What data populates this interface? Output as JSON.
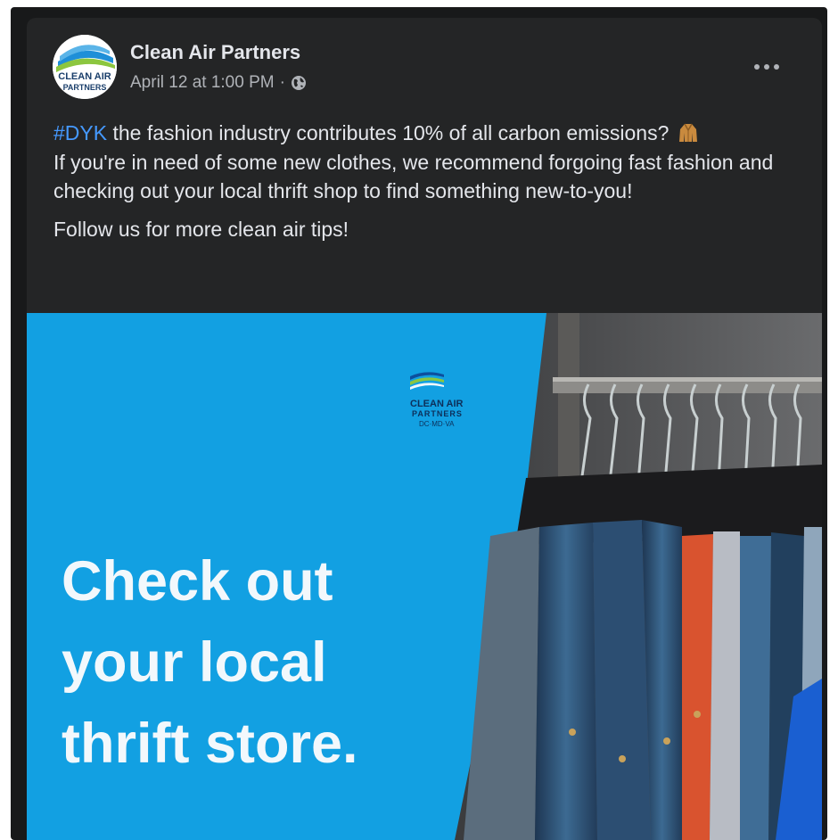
{
  "post": {
    "author": "Clean Air Partners",
    "timestamp": "April 12 at 1:00 PM",
    "separator": "·",
    "privacy_icon": "globe-icon",
    "more_icon": "more-options-icon",
    "avatar_text_line1": "CLEAN AIR",
    "avatar_text_line2": "PARTNERS",
    "hashtag": "#DYK",
    "body_line1_rest": " the fashion industry contributes 10% of all carbon emissions?",
    "body_line1_emoji": "coat-icon",
    "body_paragraph": "If you're in need of some new clothes, we recommend forgoing fast fashion and checking out your local thrift shop to find something new-to-you!",
    "follow_text": "Follow us for more clean air tips!"
  },
  "image": {
    "logo_line1": "CLEAN AIR",
    "logo_line2": "PARTNERS",
    "logo_line3": "DC·MD·VA",
    "headline": [
      "Check out",
      "your local",
      "thrift store."
    ]
  },
  "colors": {
    "background": "#242526",
    "text": "#e4e6eb",
    "secondary_text": "#b0b3b8",
    "hashtag": "#4599ff",
    "image_blue": "#12a0e2"
  }
}
